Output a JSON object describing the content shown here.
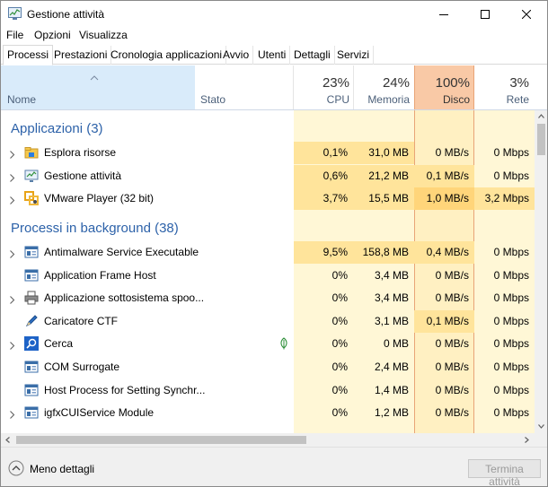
{
  "window": {
    "title": "Gestione attività"
  },
  "menu": [
    {
      "label": "File"
    },
    {
      "label": "Opzioni"
    },
    {
      "label": "Visualizza"
    }
  ],
  "tabs": [
    {
      "label": "Processi",
      "active": true
    },
    {
      "label": "Prestazioni"
    },
    {
      "label": "Cronologia applicazioni"
    },
    {
      "label": "Avvio"
    },
    {
      "label": "Utenti"
    },
    {
      "label": "Dettagli"
    },
    {
      "label": "Servizi"
    }
  ],
  "columns": {
    "nome": "Nome",
    "stato": "Stato",
    "cpu": {
      "pct": "23%",
      "label": "CPU"
    },
    "memoria": {
      "pct": "24%",
      "label": "Memoria"
    },
    "disco": {
      "pct": "100%",
      "label": "Disco"
    },
    "rete": {
      "pct": "3%",
      "label": "Rete"
    }
  },
  "groups": {
    "apps": "Applicazioni (3)",
    "background": "Processi in background (38)"
  },
  "apps": [
    {
      "name": "Esplora risorse",
      "icon": "folder-icon",
      "cpu": "0,1%",
      "mem": "31,0 MB",
      "disk": "0 MB/s",
      "net": "0 Mbps",
      "expandable": true
    },
    {
      "name": "Gestione attività",
      "icon": "task-manager-icon",
      "cpu": "0,6%",
      "mem": "21,2 MB",
      "disk": "0,1 MB/s",
      "net": "0 Mbps",
      "expandable": true
    },
    {
      "name": "VMware Player (32 bit)",
      "icon": "vmware-icon",
      "cpu": "3,7%",
      "mem": "15,5 MB",
      "disk": "1,0 MB/s",
      "net": "3,2 Mbps",
      "expandable": true
    }
  ],
  "background": [
    {
      "name": "Antimalware Service Executable",
      "icon": "service-icon",
      "cpu": "9,5%",
      "mem": "158,8 MB",
      "disk": "0,4 MB/s",
      "net": "0 Mbps",
      "expandable": true
    },
    {
      "name": "Application Frame Host",
      "icon": "service-icon",
      "cpu": "0%",
      "mem": "3,4 MB",
      "disk": "0 MB/s",
      "net": "0 Mbps",
      "expandable": false
    },
    {
      "name": "Applicazione sottosistema spoo...",
      "icon": "printer-icon",
      "cpu": "0%",
      "mem": "3,4 MB",
      "disk": "0 MB/s",
      "net": "0 Mbps",
      "expandable": true
    },
    {
      "name": "Caricatore CTF",
      "icon": "pen-icon",
      "cpu": "0%",
      "mem": "3,1 MB",
      "disk": "0,1 MB/s",
      "net": "0 Mbps",
      "expandable": false
    },
    {
      "name": "Cerca",
      "icon": "search-icon",
      "cpu": "0%",
      "mem": "0 MB",
      "disk": "0 MB/s",
      "net": "0 Mbps",
      "expandable": true,
      "suspended": true
    },
    {
      "name": "COM Surrogate",
      "icon": "service-icon",
      "cpu": "0%",
      "mem": "2,4 MB",
      "disk": "0 MB/s",
      "net": "0 Mbps",
      "expandable": false
    },
    {
      "name": "Host Process for Setting Synchr...",
      "icon": "service-icon",
      "cpu": "0%",
      "mem": "1,4 MB",
      "disk": "0 MB/s",
      "net": "0 Mbps",
      "expandable": false
    },
    {
      "name": "igfxCUIService Module",
      "icon": "service-icon",
      "cpu": "0%",
      "mem": "1,2 MB",
      "disk": "0 MB/s",
      "net": "0 Mbps",
      "expandable": true
    }
  ],
  "footer": {
    "less_details": "Meno dettagli",
    "end_task": "Termina attività"
  },
  "colors": {
    "group_title": "#2d62a9",
    "disk_header": "#f9c9a6",
    "heat_low": "#fff4c4",
    "heat_mid": "#ffe49b",
    "heat_high": "#ffd57a"
  }
}
